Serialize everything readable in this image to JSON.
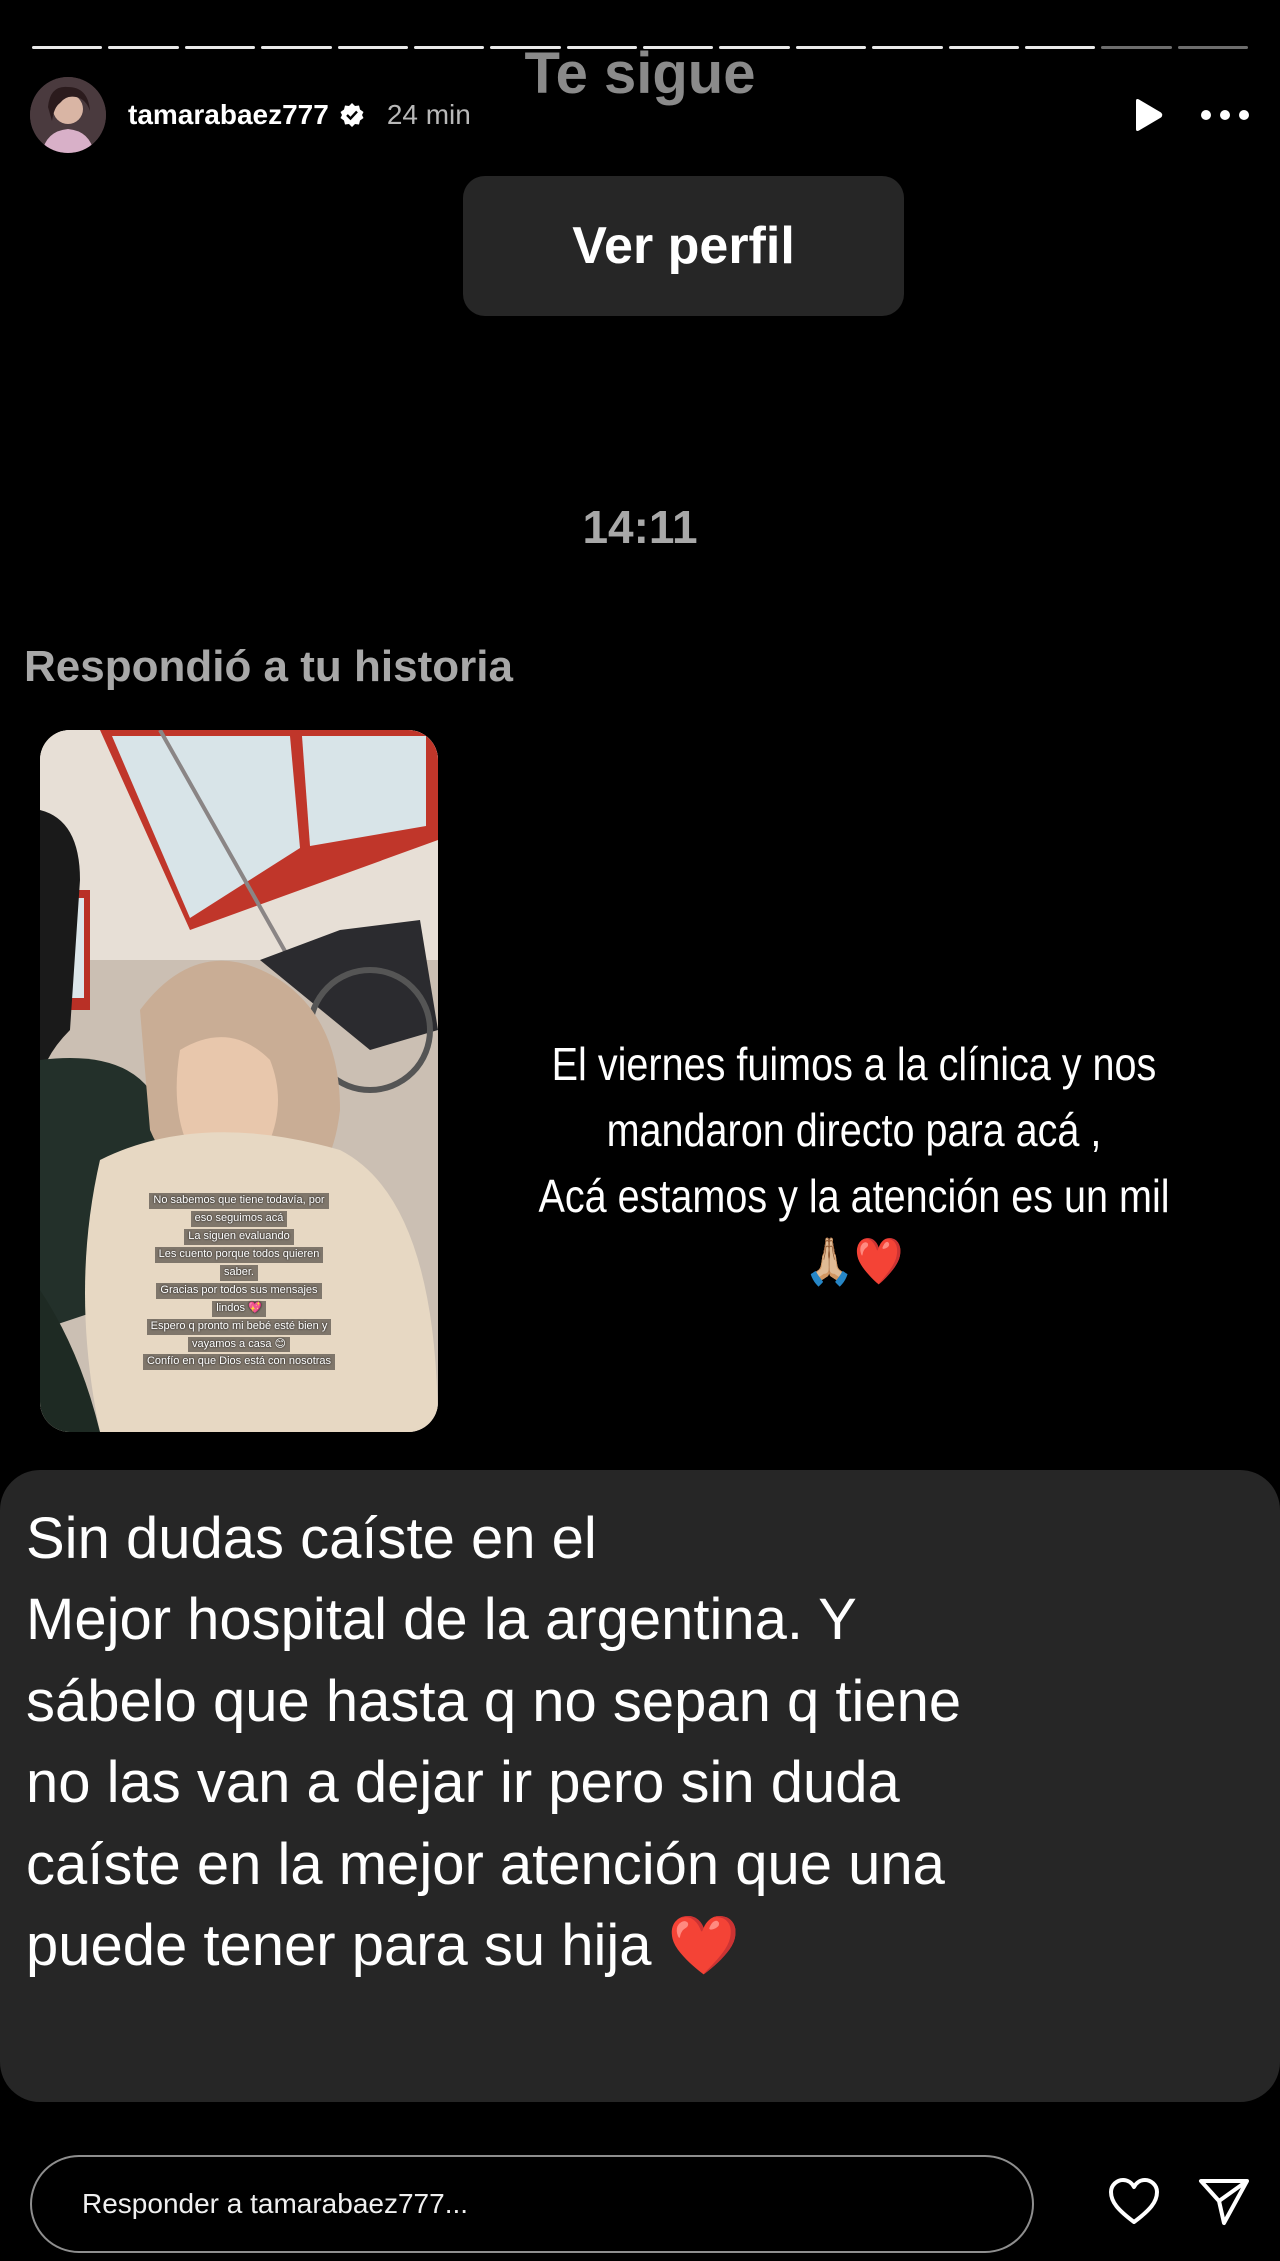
{
  "header": {
    "username": "tamarabaez777",
    "time_ago": "24 min"
  },
  "profile": {
    "follows_you": "Te sigue",
    "view_profile_label": "Ver perfil"
  },
  "thread": {
    "timestamp": "14:11",
    "reply_context": "Respondió a tu historia",
    "story_caption": [
      "El viernes fuimos a la clínica  y nos",
      "mandaron directo para acá ,",
      "Acá estamos y la atención es un mil",
      "🙏🏼❤️"
    ],
    "story_overlay_text": [
      "No sabemos que tiene todavía, por",
      "eso seguimos acá",
      "La siguen evaluando",
      "Les cuento porque todos quieren",
      "saber.",
      "Gracias por todos sus mensajes",
      "lindos 💖",
      "Espero q pronto mi bebé esté bien y",
      "vayamos a casa 😊",
      "Confío en que Dios está con nosotras"
    ],
    "message_lines": [
      "Sin dudas caíste en el",
      "Mejor hospital de la argentina. Y",
      "sábelo que hasta q no sepan q tiene",
      "no las van a dejar ir pero sin duda",
      "caíste en la mejor atención que una",
      "puede tener para su hija ❤️"
    ]
  },
  "reply": {
    "placeholder": "Responder a tamarabaez777..."
  },
  "icons": {
    "verified": "verified-badge-icon",
    "play": "play-icon",
    "more": "more-icon",
    "like": "heart-icon",
    "send": "send-icon"
  }
}
